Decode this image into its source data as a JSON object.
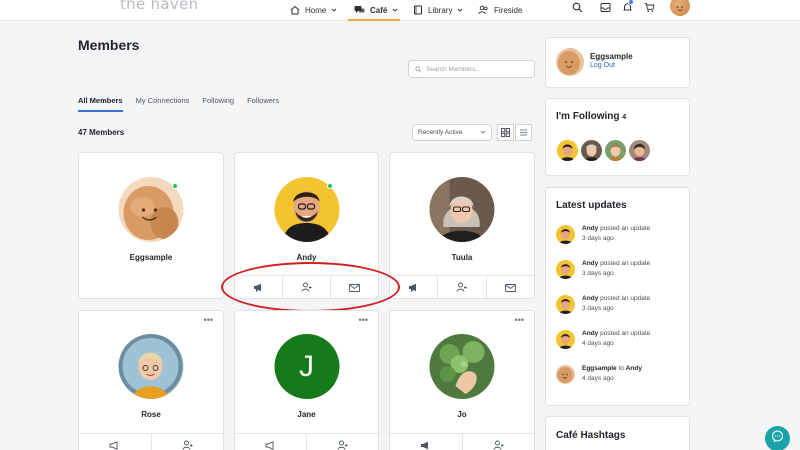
{
  "brand": {
    "logo_text": "the haven"
  },
  "nav": {
    "items": [
      {
        "label": "Home",
        "icon": "home-icon"
      },
      {
        "label": "Café",
        "icon": "chat-bubbles-icon"
      },
      {
        "label": "Library",
        "icon": "book-icon"
      },
      {
        "label": "Fireside",
        "icon": "people-icon"
      }
    ]
  },
  "page": {
    "title": "Members",
    "search_placeholder": "Search Members...",
    "tabs": [
      "All Members",
      "My Connections",
      "Following",
      "Followers"
    ],
    "member_count": "47 Members",
    "sort_selected": "Recently Active"
  },
  "members": [
    {
      "name": "Eggsample"
    },
    {
      "name": "Andy"
    },
    {
      "name": "Tuula"
    },
    {
      "name": "Rose"
    },
    {
      "name": "Jane",
      "initial": "J"
    },
    {
      "name": "Jo"
    }
  ],
  "sidebar": {
    "profile": {
      "name": "Eggsample",
      "logout": "Log Out"
    },
    "following": {
      "title": "I'm Following",
      "count": "4"
    },
    "updates": {
      "title": "Latest updates",
      "items": [
        {
          "user": "Andy",
          "text": "posted an update",
          "time": "3 days ago"
        },
        {
          "user": "Andy",
          "text": "posted an update",
          "time": "3 days ago"
        },
        {
          "user": "Andy",
          "text": "posted an update",
          "time": "3 days ago"
        },
        {
          "user": "Andy",
          "text": "posted an update",
          "time": "4 days ago"
        },
        {
          "user": "Eggsample",
          "text": "to",
          "user2": "Andy",
          "time": "4 days ago"
        }
      ]
    },
    "hashtags": {
      "title": "Café Hashtags"
    }
  },
  "colors": {
    "accent_underline": "#f2a541",
    "tab_active": "#3a6fd8",
    "online": "#22c55e",
    "highlight": "#cf1f1f",
    "chat_button": "#1aa3a8",
    "jane_avatar": "#157a1a"
  }
}
